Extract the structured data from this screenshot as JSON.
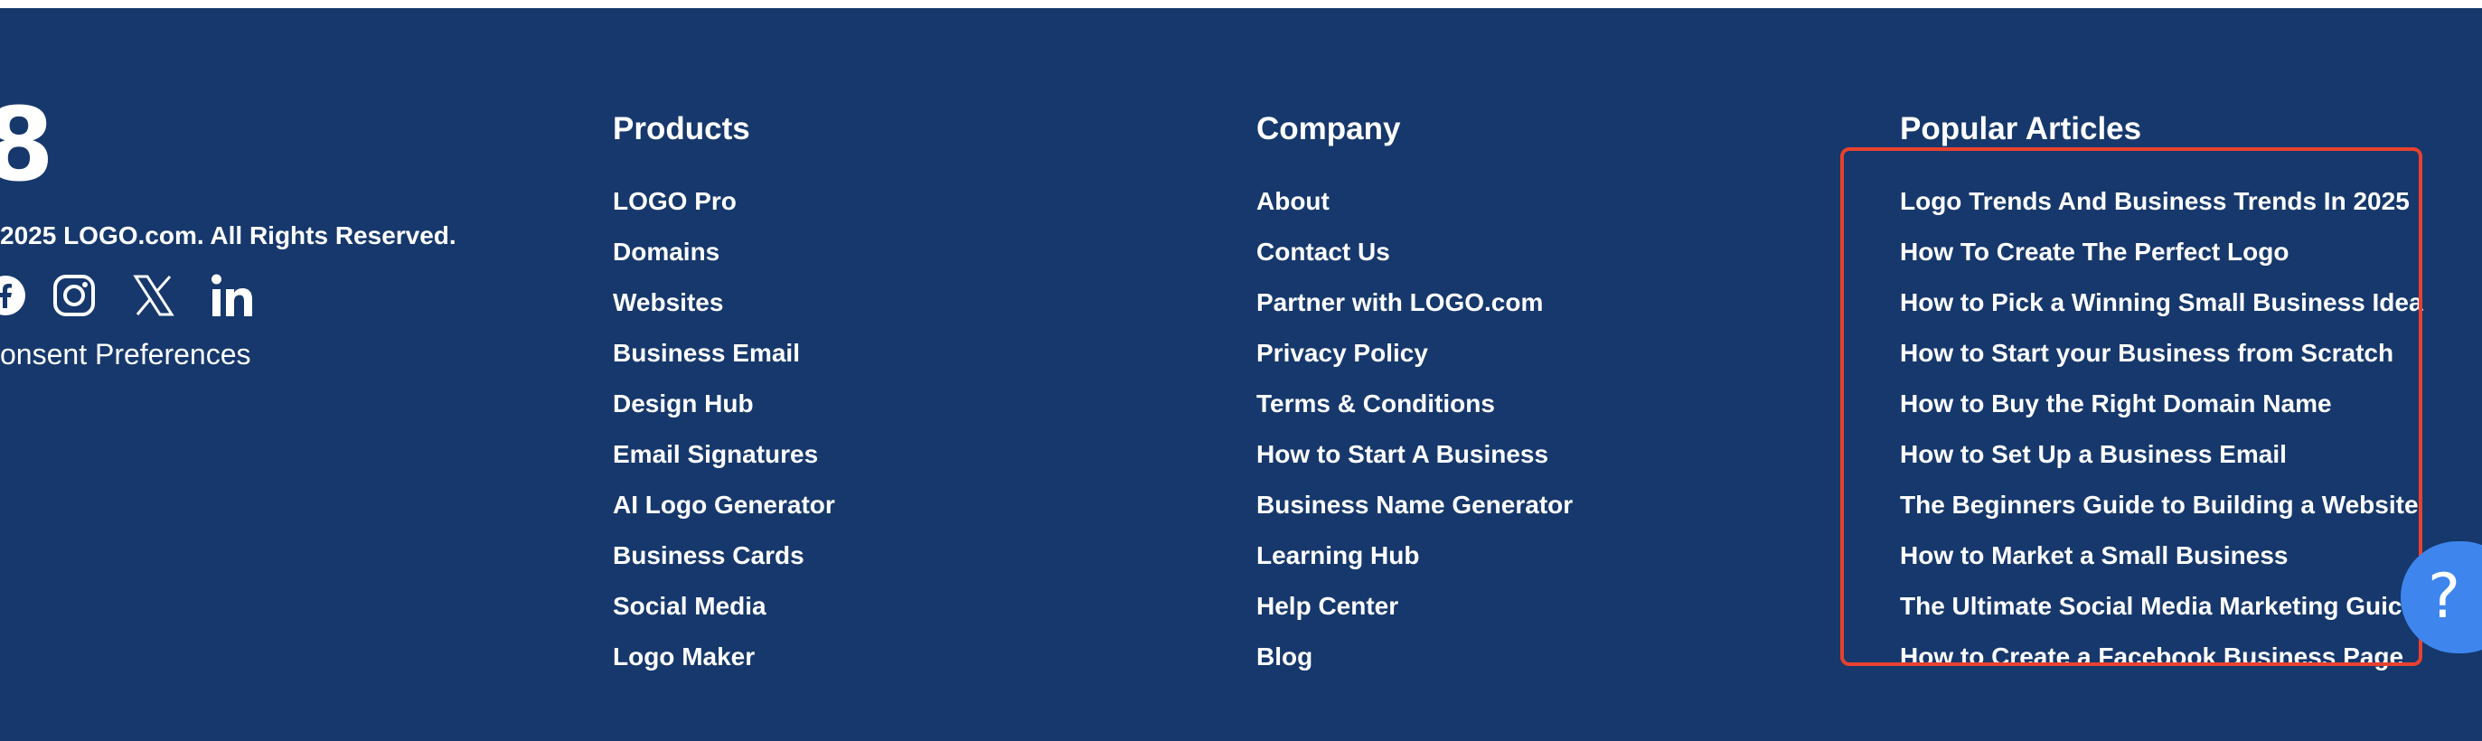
{
  "brand": {
    "logo_glyph": "8",
    "copyright": "2025 LOGO.com. All Rights Reserved.",
    "consent_label": "onsent Preferences"
  },
  "social": [
    {
      "name": "facebook",
      "icon": "facebook-icon"
    },
    {
      "name": "instagram",
      "icon": "instagram-icon"
    },
    {
      "name": "x",
      "icon": "x-icon"
    },
    {
      "name": "linkedin",
      "icon": "linkedin-icon"
    }
  ],
  "columns": {
    "products": {
      "title": "Products",
      "items": [
        "LOGO Pro",
        "Domains",
        "Websites",
        "Business Email",
        "Design Hub",
        "Email Signatures",
        "AI Logo Generator",
        "Business Cards",
        "Social Media",
        "Logo Maker"
      ]
    },
    "company": {
      "title": "Company",
      "items": [
        "About",
        "Contact Us",
        "Partner with LOGO.com",
        "Privacy Policy",
        "Terms & Conditions",
        "How to Start A Business",
        "Business Name Generator",
        "Learning Hub",
        "Help Center",
        "Blog"
      ]
    },
    "articles": {
      "title": "Popular Articles",
      "items": [
        "Logo Trends And Business Trends In 2025",
        "How To Create The Perfect Logo",
        "How to Pick a Winning Small Business Idea",
        "How to Start your Business from Scratch",
        "How to Buy the Right Domain Name",
        "How to Set Up a Business Email",
        "The Beginners Guide to Building a Website",
        "How to Market a Small Business",
        "The Ultimate Social Media Marketing Guic",
        "How to Create a Facebook Business Page"
      ]
    }
  },
  "help": {
    "glyph": "?",
    "icon": "help-icon"
  },
  "colors": {
    "background": "#16386c",
    "highlight": "#e8412f",
    "help": "#3e86ee",
    "text": "#ffffff"
  }
}
